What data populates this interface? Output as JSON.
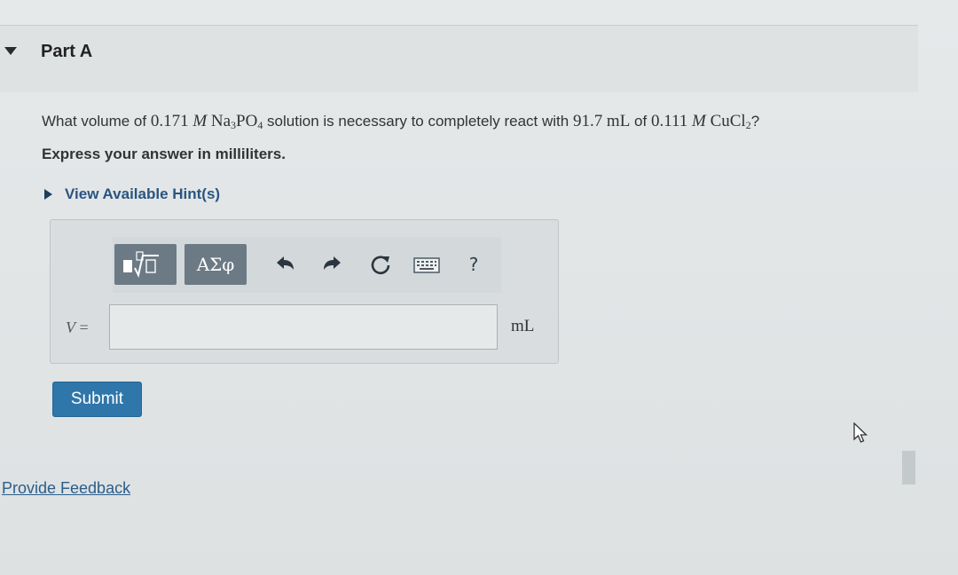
{
  "part": {
    "title": "Part A"
  },
  "question": {
    "prefix": "What volume of ",
    "conc1": "0.171",
    "molar_unit": "M",
    "reactant1_main": "Na",
    "reactant1_sub1": "3",
    "reactant1_mid": "PO",
    "reactant1_sub2": "4",
    "middle_text": " solution is necessary to completely react with ",
    "volume": "91.7",
    "volume_unit": "mL",
    "of_text": " of ",
    "conc2": "0.111",
    "reactant2_main": "CuCl",
    "reactant2_sub": "2",
    "suffix": "?"
  },
  "instruction": "Express your answer in milliliters.",
  "hint": {
    "label": "View Available Hint(s)"
  },
  "toolbar": {
    "templates_icon": "templates-sqrt-icon",
    "greek_label": "ΑΣφ",
    "undo_icon": "undo-icon",
    "redo_icon": "redo-icon",
    "reset_icon": "reset-icon",
    "keyboard_icon": "keyboard-icon",
    "help_label": "?"
  },
  "answer": {
    "variable": "V",
    "equals": " =",
    "value": "",
    "unit": "mL"
  },
  "submit_label": "Submit",
  "feedback_label": "Provide Feedback",
  "colors": {
    "accent": "#2f76aa",
    "toolbar_button": "#6c7a86",
    "link": "#2a5580"
  }
}
